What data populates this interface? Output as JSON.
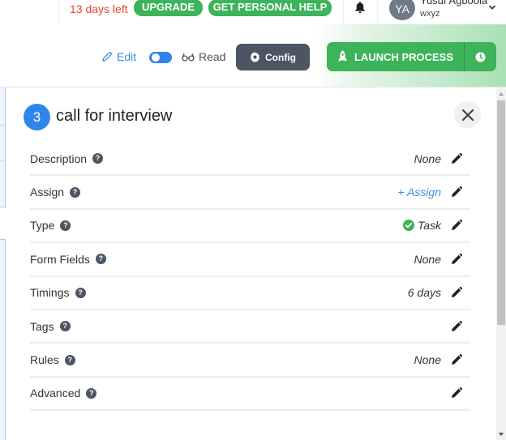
{
  "topbar": {
    "trial_text": "13 days left",
    "upgrade_label": "UPGRADE",
    "help_label": "GET PERSONAL HELP",
    "notifications_icon": "bell-icon",
    "user": {
      "initials": "YA",
      "name": "Yusuf Agboola",
      "org": "wxyz",
      "menu_icon": "chevron-down-icon"
    }
  },
  "toolbar": {
    "edit_label": "Edit",
    "read_label": "Read",
    "mode_toggle_on": false,
    "config_label": "Config",
    "launch_label": "LAUNCH PROCESS",
    "launch_icon": "rocket-icon",
    "schedule_icon": "clock-icon"
  },
  "task": {
    "step_number": "3",
    "title": "call for interview",
    "close_icon": "close-icon",
    "rows": [
      {
        "label": "Description",
        "value": "None",
        "value_style": "italic"
      },
      {
        "label": "Assign",
        "value": "+ Assign",
        "value_style": "link"
      },
      {
        "label": "Type",
        "value": "Task",
        "value_style": "italic",
        "value_icon": "check-circle-icon"
      },
      {
        "label": "Form Fields",
        "value": "None",
        "value_style": "italic"
      },
      {
        "label": "Timings",
        "value": "6 days",
        "value_style": "italic"
      },
      {
        "label": "Tags",
        "value": ""
      },
      {
        "label": "Rules",
        "value": "None",
        "value_style": "italic"
      },
      {
        "label": "Advanced",
        "value": ""
      }
    ]
  },
  "colors": {
    "accent_blue": "#2f86ea",
    "success_green": "#3db35a",
    "warning_red": "#e8472e",
    "config_gray": "#4b5563"
  }
}
